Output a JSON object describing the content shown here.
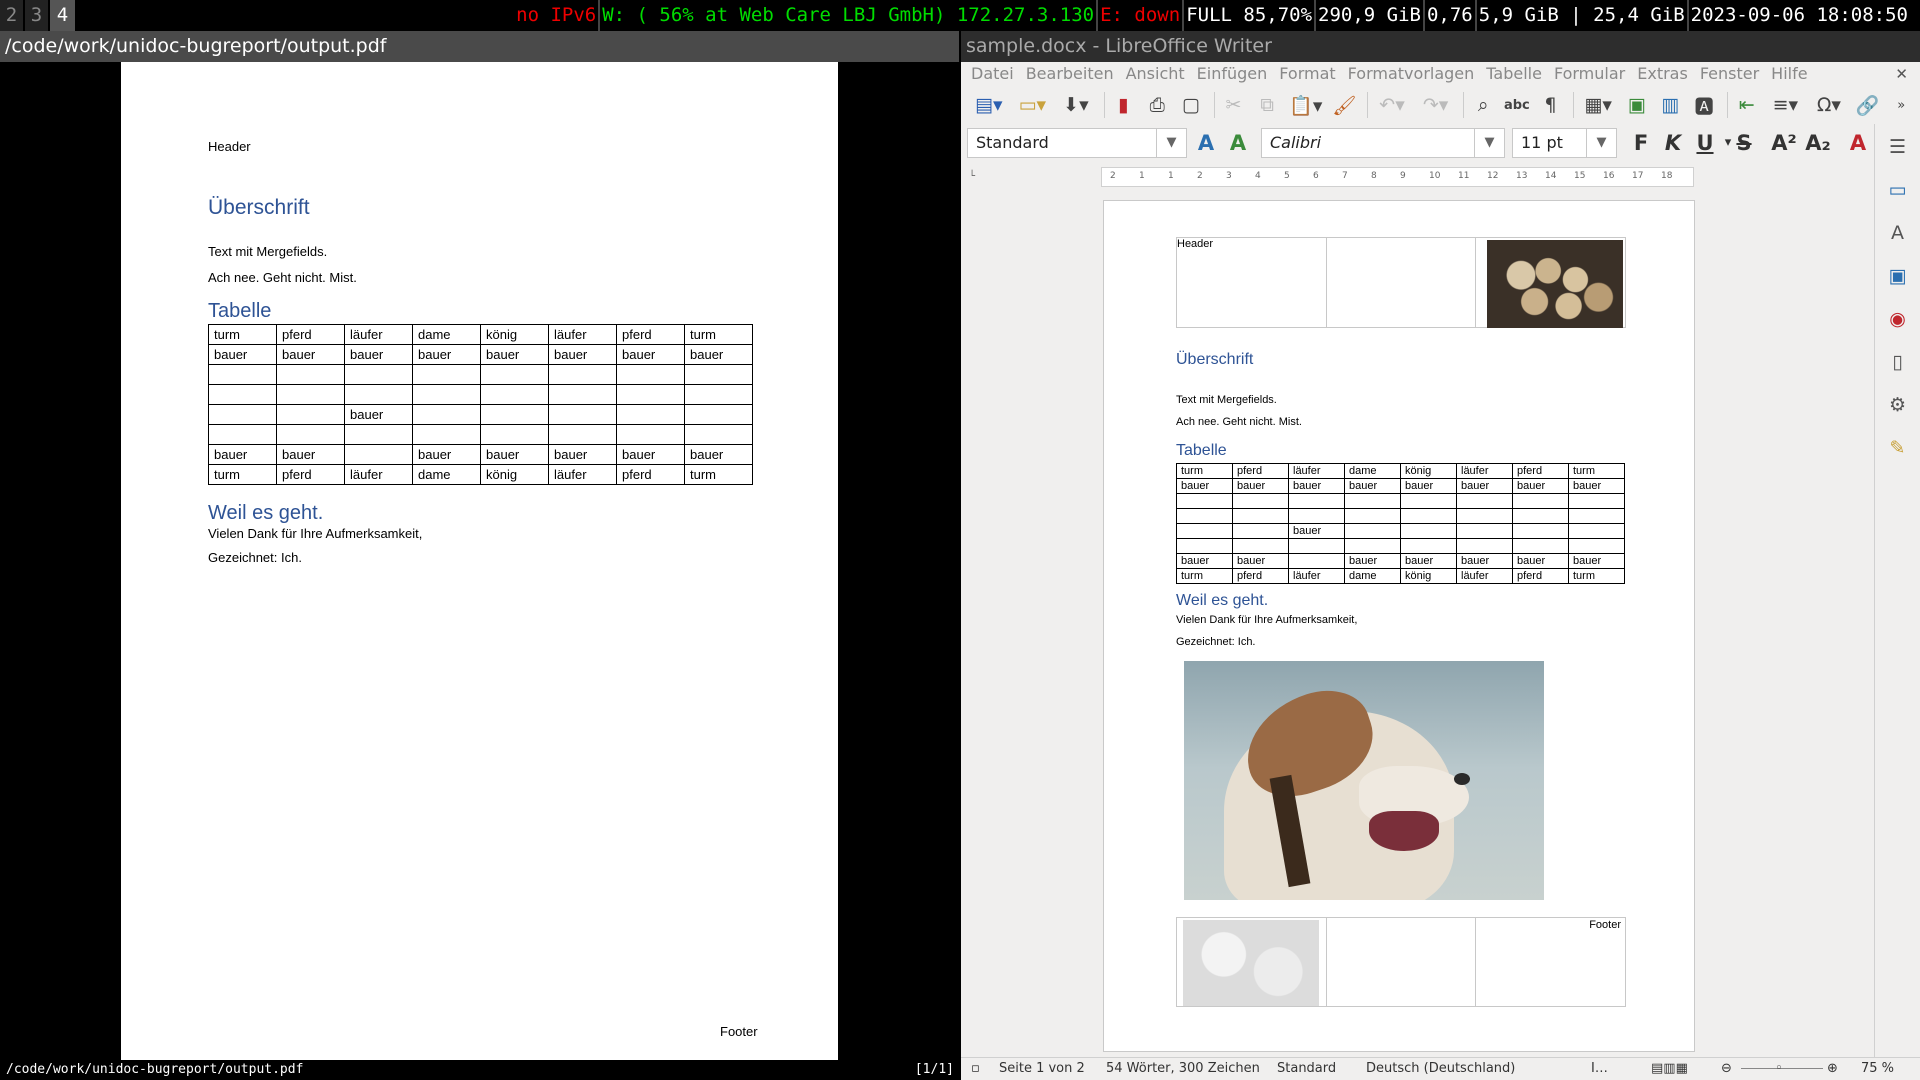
{
  "topbar": {
    "workspaces": [
      "2",
      "3",
      "4"
    ],
    "active_workspace": "4",
    "ipv6": "no IPv6",
    "wifi": "W: ( 56% at Web Care LBJ GmbH) 172.27.3.130",
    "ethernet": "E: down",
    "battery": "FULL 85,70%",
    "disk": "290,9 GiB",
    "load": "0,76",
    "memory": "5,9 GiB | 25,4 GiB",
    "datetime": "2023-09-06 18:08:50"
  },
  "pdf_viewer": {
    "title": "/code/work/unidoc-bugreport/output.pdf",
    "status_path": "/code/work/unidoc-bugreport/output.pdf",
    "page_indicator": "[1/1]",
    "header": "Header",
    "heading1": "Überschrift",
    "paragraph1": "Text mit Mergefields.",
    "paragraph2": "Ach nee. Geht nicht. Mist.",
    "heading_table": "Tabelle",
    "heading2": "Weil es geht.",
    "paragraph3": "Vielen Dank für Ihre Aufmerksamkeit,",
    "paragraph4": "Gezeichnet: Ich.",
    "footer": "Footer"
  },
  "table": {
    "rows": [
      [
        "turm",
        "pferd",
        "läufer",
        "dame",
        "könig",
        "läufer",
        "pferd",
        "turm"
      ],
      [
        "bauer",
        "bauer",
        "bauer",
        "bauer",
        "bauer",
        "bauer",
        "bauer",
        "bauer"
      ],
      [
        "",
        "",
        "",
        "",
        "",
        "",
        "",
        ""
      ],
      [
        "",
        "",
        "",
        "",
        "",
        "",
        "",
        ""
      ],
      [
        "",
        "",
        "bauer",
        "",
        "",
        "",
        "",
        ""
      ],
      [
        "",
        "",
        "",
        "",
        "",
        "",
        "",
        ""
      ],
      [
        "bauer",
        "bauer",
        "",
        "bauer",
        "bauer",
        "bauer",
        "bauer",
        "bauer"
      ],
      [
        "turm",
        "pferd",
        "läufer",
        "dame",
        "könig",
        "läufer",
        "pferd",
        "turm"
      ]
    ]
  },
  "writer": {
    "title": "sample.docx - LibreOffice Writer",
    "menus": [
      "Datei",
      "Bearbeiten",
      "Ansicht",
      "Einfügen",
      "Format",
      "Formatvorlagen",
      "Tabelle",
      "Formular",
      "Extras",
      "Fenster",
      "Hilfe"
    ],
    "paragraph_style": "Standard",
    "font_name": "Calibri",
    "font_size": "11 pt",
    "ruler_labels": [
      "2",
      "1",
      "1",
      "2",
      "3",
      "4",
      "5",
      "6",
      "7",
      "8",
      "9",
      "10",
      "11",
      "12",
      "13",
      "14",
      "15",
      "16",
      "17",
      "18"
    ],
    "doc": {
      "header": "Header",
      "heading1": "Überschrift",
      "paragraph1": "Text mit Mergefields.",
      "paragraph2": "Ach nee. Geht nicht. Mist.",
      "heading_table": "Tabelle",
      "heading2": "Weil es geht.",
      "paragraph3": "Vielen Dank für Ihre Aufmerksamkeit,",
      "paragraph4": "Gezeichnet: Ich.",
      "footer": "Footer"
    },
    "status": {
      "page": "Seite 1 von 2",
      "words": "54 Wörter, 300 Zeichen",
      "page_style": "Standard",
      "language": "Deutsch (Deutschland)",
      "zoom": "75 %"
    }
  }
}
